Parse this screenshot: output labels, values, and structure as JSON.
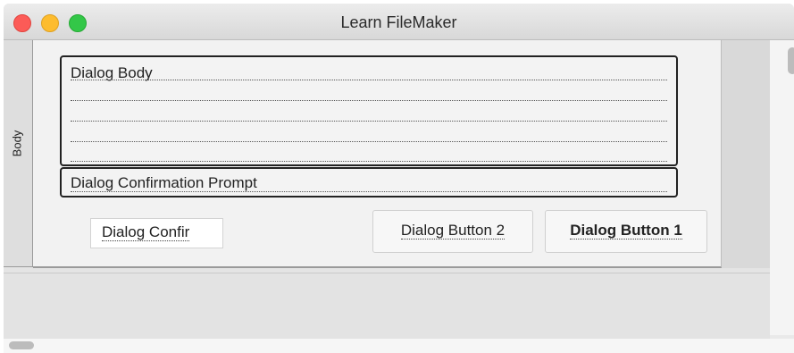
{
  "window": {
    "title": "Learn FileMaker"
  },
  "layout": {
    "part_label": "Body",
    "fields": {
      "dialog_body": "Dialog Body",
      "dialog_prompt": "Dialog Confirmation Prompt"
    },
    "buttons": {
      "confirm": "Dialog Confir",
      "button2": "Dialog Button 2",
      "button1": "Dialog Button 1"
    }
  },
  "colors": {
    "close": "#fc5b57",
    "minimize": "#fdbc2e",
    "maximize": "#33c748"
  }
}
